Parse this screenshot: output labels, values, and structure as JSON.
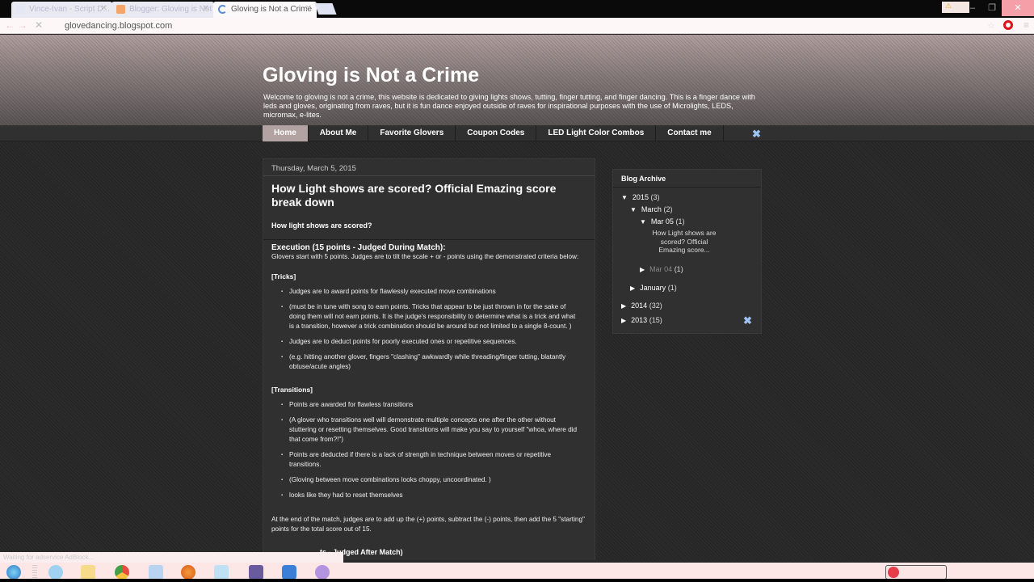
{
  "browser": {
    "tabs": [
      {
        "label": "Vince-Ivan - Script D...",
        "icon": "page-icon",
        "active": false
      },
      {
        "label": "Blogger: Gloving is Not a...",
        "icon": "blogger-icon",
        "active": false
      },
      {
        "label": "Gloving is Not a Crime",
        "icon": "loading-icon",
        "active": true
      }
    ],
    "url": "glovedancing.blogspot.com",
    "status_text": "Waiting for adservice AdBlock..."
  },
  "blog": {
    "title": "Gloving is Not a Crime",
    "description": "Welcome to gloving is not a crime, this website is dedicated to giving lights shows, tutting, finger tutting, and finger dancing. This is a finger dance with leds and gloves, originating from raves, but it is fun dance enjoyed outside of raves for inspirational purposes with the use of Microlights, LEDS, micromax, e-lites."
  },
  "nav": {
    "tabs": [
      "Home",
      "About Me",
      "Favorite Glovers",
      "Coupon Codes",
      "LED Light Color Combos",
      "Contact me"
    ],
    "active": "Home"
  },
  "post": {
    "date": "Thursday, March 5, 2015",
    "title": "How Light shows are scored? Official Emazing score break down",
    "subtitle": "How light shows are scored?",
    "execution_heading": "Execution (15  points - Judged During Match):",
    "execution_intro": "Glovers start with 5 points. Judges are to tilt the scale + or - points using the demonstrated criteria below:",
    "tricks": {
      "heading": "[Tricks]",
      "items": [
        "Judges are to award points for flawlessly executed move combinations",
        "(must be in tune with song to earn points. Tricks that appear to be just thrown in for the sake of doing them will not earn points. It is the judge's responsibility to determine what is a trick and what is a transition, however a trick combination should be around but not limited to  a single 8-count. )",
        "Judges are to deduct points for poorly executed ones or repetitive sequences.",
        "(e.g. hitting another glover, fingers \"clashing\" awkwardly while threading/finger tutting, blatantly obtuse/acute angles)"
      ]
    },
    "transitions": {
      "heading": "[Transitions]",
      "items": [
        "Points are awarded for flawless transitions",
        "(A glover who transitions well will demonstrate multiple concepts one after the other without stuttering or resetting themselves. Good transitions will make you say to yourself \"whoa, where did that come from?!\")",
        "Points are deducted if there is a lack of strength in technique  between moves or repetitive transitions.",
        "(Gloving between move combinations looks choppy, uncoordinated. )",
        "looks like they had to reset themselves"
      ]
    },
    "summary": "At the end of the match, judges are to add up the (+) points, subtract the (-) points, then add the 5 \"starting\" points for the total score out of 15.",
    "next_heading_partial": "ts - Judged After Match)"
  },
  "archive": {
    "title": "Blog Archive",
    "entries": [
      {
        "label": "2015",
        "count": "(3)",
        "expanded": true
      },
      {
        "label": "March",
        "count": "(2)",
        "expanded": true
      },
      {
        "label": "Mar 05",
        "count": "(1)",
        "expanded": true
      },
      {
        "label": "Mar 04",
        "count": "(1)",
        "expanded": false
      },
      {
        "label": "January",
        "count": "(1)",
        "expanded": false
      },
      {
        "label": "2014",
        "count": "(32)",
        "expanded": false
      },
      {
        "label": "2013",
        "count": "(15)",
        "expanded": false
      }
    ],
    "post_link": "How Light shows are scored? Official Emazing score..."
  },
  "icons": {
    "expanded": "▼",
    "collapsed": "▶",
    "tools": "✖",
    "close": "✕",
    "minimize": "–",
    "maximize": "❐",
    "stop": "✕",
    "star": "☆",
    "menu": "≡",
    "back": "←",
    "forward": "→"
  },
  "taskbar": {
    "apps": [
      "start",
      "internet-explorer",
      "file-explorer",
      "chrome",
      "window-manager",
      "firefox",
      "notepad",
      "pro-app",
      "teamviewer",
      "viber"
    ]
  }
}
